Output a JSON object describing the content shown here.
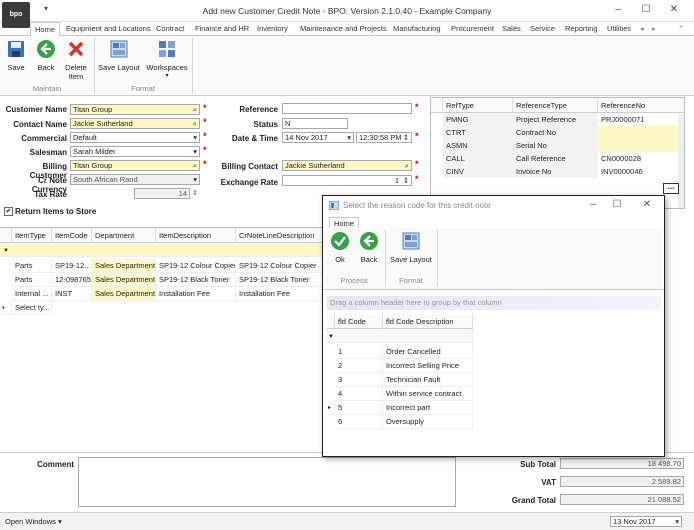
{
  "window": {
    "title": "Add new Customer Credit Note - BPO: Version 2.1.0.40 - Example Company",
    "logo": "bpo",
    "qat_arrow": "▾"
  },
  "ribbon": {
    "tabs": [
      "Home",
      "Equipment and Locations",
      "Contract",
      "Finance and HR",
      "Inventory",
      "Maintenance and Projects",
      "Manufacturing",
      "Procurement",
      "Sales",
      "Service",
      "Reporting",
      "Utilities"
    ],
    "buttons": {
      "save": "Save",
      "back": "Back",
      "delete_item": "Delete Item",
      "save_layout": "Save Layout",
      "workspaces": "Workspaces"
    },
    "groups": {
      "maintain": "Maintain",
      "format": "Format"
    }
  },
  "form": {
    "customer_name": {
      "label": "Customer Name",
      "value": "Titan Group"
    },
    "contact_name": {
      "label": "Contact Name",
      "value": "Jackie Sutherland"
    },
    "commercial": {
      "label": "Commercial",
      "value": "Default"
    },
    "salesman": {
      "label": "Salesman",
      "value": "Sarah Milder"
    },
    "billing_customer": {
      "label": "Billing Customer",
      "value": "Titan Group"
    },
    "cr_note_currency": {
      "label": "Cr Note Currency",
      "value": "South African Rand"
    },
    "tax_rate": {
      "label": "Tax Rate",
      "value": "14"
    },
    "reference": {
      "label": "Reference",
      "value": ""
    },
    "status": {
      "label": "Status",
      "value": "N"
    },
    "date_time": {
      "label": "Date & Time",
      "date": "14 Nov 2017",
      "time": "12:30:58 PM"
    },
    "billing_contact": {
      "label": "Billing Contact",
      "value": "Jackie Sutherland"
    },
    "exchange_rate": {
      "label": "Exchange Rate",
      "value": "1"
    },
    "return_items": {
      "label": "Return Items to Store",
      "checked": true
    }
  },
  "ref_grid": {
    "headers": [
      "RefType",
      "ReferenceType",
      "ReferenceNo"
    ],
    "rows": [
      [
        "PMNG",
        "Project Reference",
        "PRJ0000071"
      ],
      [
        "CTRT",
        "Contract No",
        ""
      ],
      [
        "ASMN",
        "Serial No",
        ""
      ],
      [
        "CALL",
        "Call Reference",
        "CN0000028"
      ],
      [
        "CINV",
        "Invoice No",
        "INV0000046"
      ]
    ],
    "ellipsis": "..."
  },
  "items_grid": {
    "headers": [
      "ItemType",
      "ItemCode",
      "Department",
      "ItemDescription",
      "CrNoteLineDescription"
    ],
    "rows": [
      [
        "Parts",
        "SP19-12...",
        "Sales Department",
        "SP19-12 Colour Copier",
        "SP19-12 Colour Copier"
      ],
      [
        "Parts",
        "12-098765",
        "Sales Department",
        "SP19-12 Black Toner",
        "SP19-12 Black Toner"
      ],
      [
        "Internal ...",
        "INST",
        "Sales Department",
        "Installation Fee",
        "Installation Fee"
      ]
    ],
    "new_row": "Select ty..."
  },
  "totals": {
    "comment_label": "Comment",
    "sub_total": {
      "label": "Sub Total",
      "value": "18 498.70"
    },
    "vat": {
      "label": "VAT",
      "value": "2 589.82"
    },
    "grand_total": {
      "label": "Grand Total",
      "value": "21 088.52"
    }
  },
  "statusbar": {
    "open_windows": "Open Windows",
    "date": "13 Nov 2017"
  },
  "dialog": {
    "title": "Select the reason code for this credit note",
    "tab": "Home",
    "buttons": {
      "ok": "Ok",
      "back": "Back",
      "save_layout": "Save Layout"
    },
    "groups": {
      "process": "Process",
      "format": "Format"
    },
    "group_hint": "Drag a column header here to group by that column",
    "headers": [
      "fld Code",
      "fld Code Description"
    ],
    "rows": [
      [
        "1",
        "Order Cancelled"
      ],
      [
        "2",
        "Incorrect Selling Price"
      ],
      [
        "3",
        "Technician Fault"
      ],
      [
        "4",
        "Within service contract"
      ],
      [
        "5",
        "Incorrect part"
      ],
      [
        "6",
        "Oversupply"
      ]
    ]
  },
  "colors": {
    "required_field": "#fdf8c4",
    "required_star": "#dd0000",
    "accent_green": "#3aa04a"
  }
}
